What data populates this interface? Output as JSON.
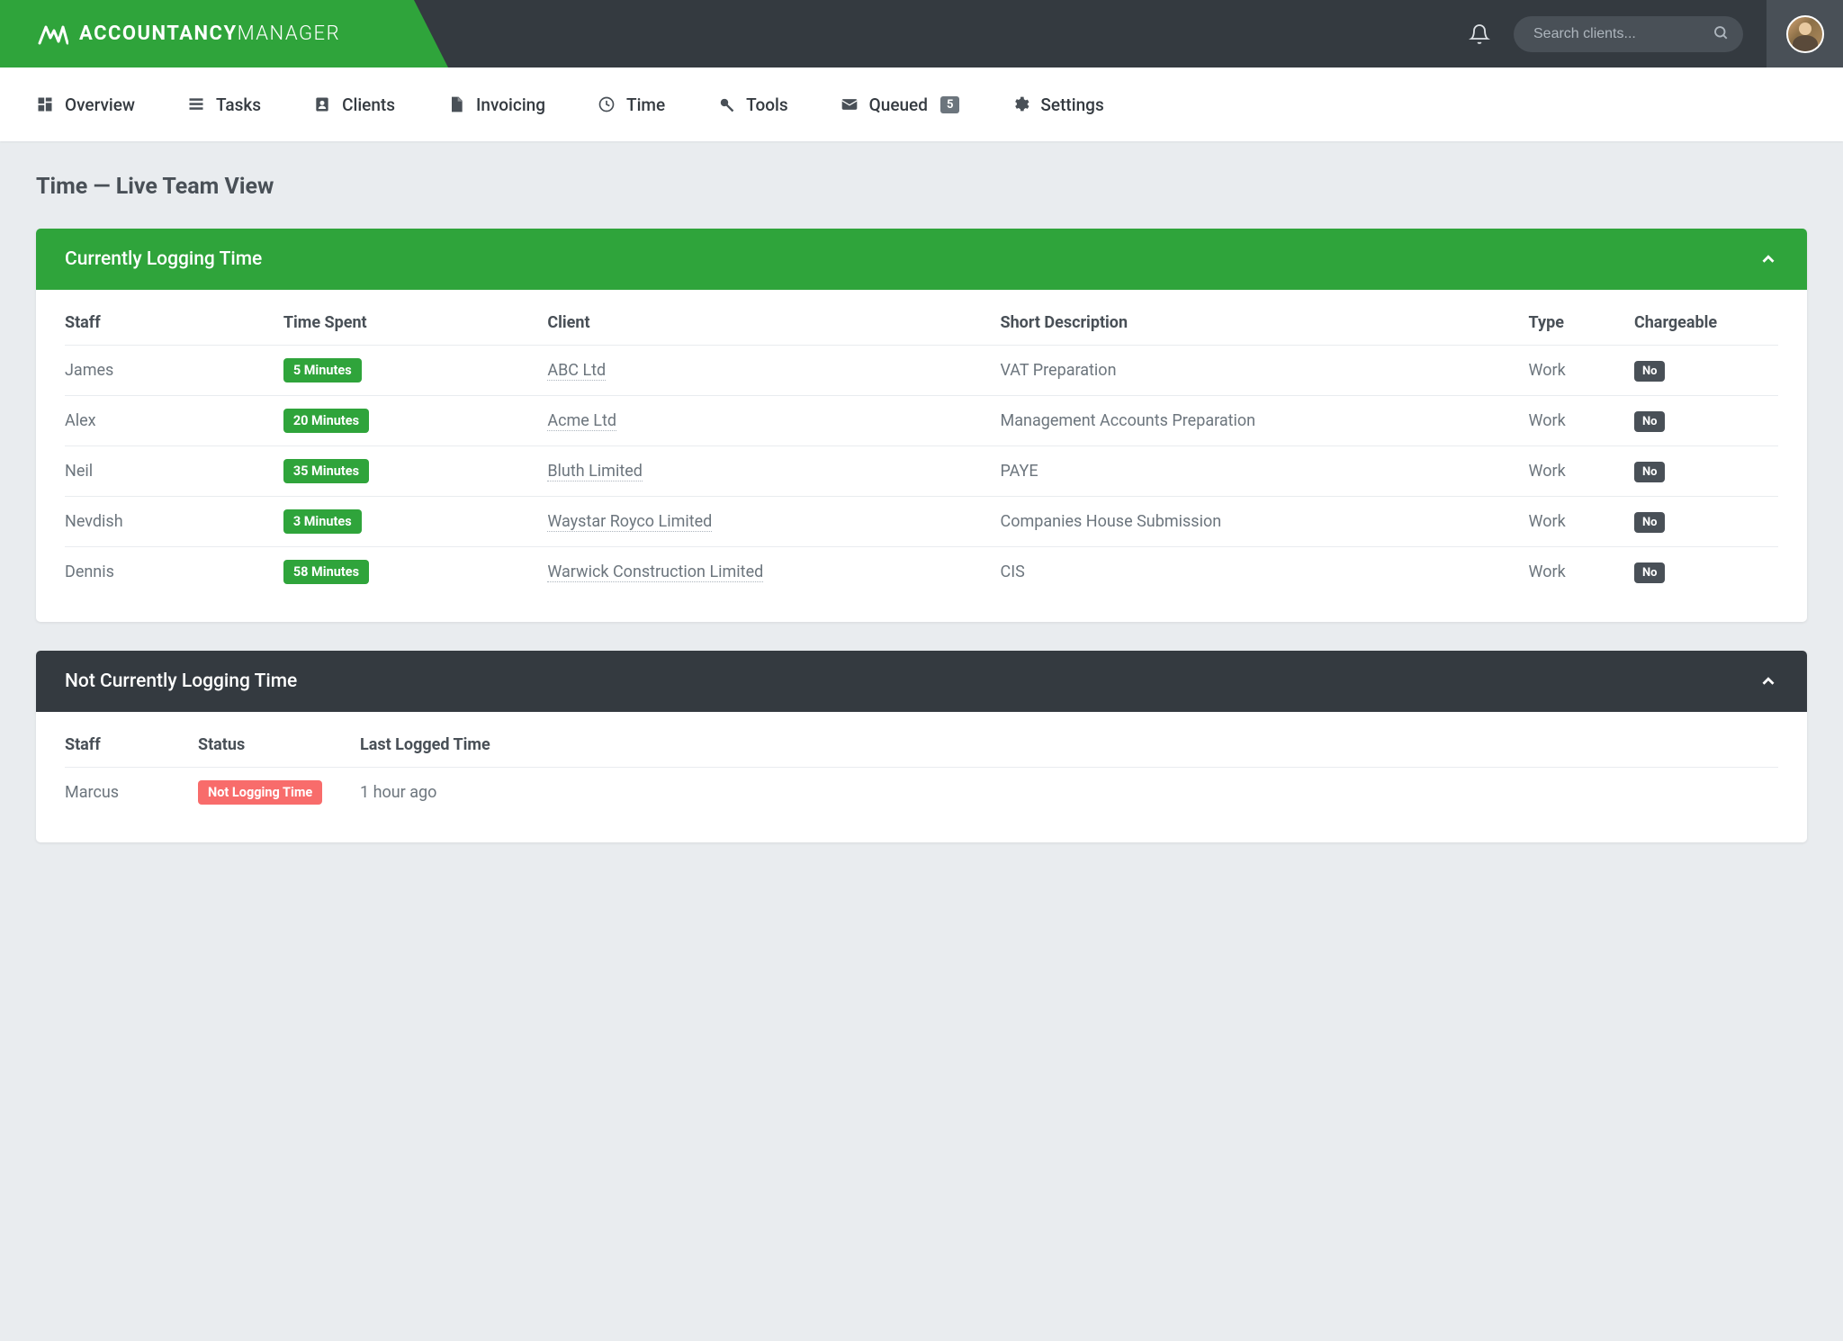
{
  "header": {
    "logo_bold": "ACCOUNTANCY",
    "logo_light": "MANAGER",
    "search_placeholder": "Search clients..."
  },
  "nav": {
    "items": [
      {
        "label": "Overview"
      },
      {
        "label": "Tasks"
      },
      {
        "label": "Clients"
      },
      {
        "label": "Invoicing"
      },
      {
        "label": "Time"
      },
      {
        "label": "Tools"
      },
      {
        "label": "Queued",
        "badge": "5"
      },
      {
        "label": "Settings"
      }
    ]
  },
  "page": {
    "title": "Time — Live Team View"
  },
  "panel_logging": {
    "title": "Currently Logging Time",
    "columns": {
      "staff": "Staff",
      "time_spent": "Time Spent",
      "client": "Client",
      "short_desc": "Short Description",
      "type": "Type",
      "chargeable": "Chargeable"
    },
    "rows": [
      {
        "staff": "James",
        "time": "5 Minutes",
        "client": "ABC Ltd",
        "desc": "VAT Preparation",
        "type": "Work",
        "chargeable": "No"
      },
      {
        "staff": "Alex",
        "time": "20 Minutes",
        "client": "Acme Ltd",
        "desc": "Management Accounts Preparation",
        "type": "Work",
        "chargeable": "No"
      },
      {
        "staff": "Neil",
        "time": "35 Minutes",
        "client": "Bluth Limited",
        "desc": "PAYE",
        "type": "Work",
        "chargeable": "No"
      },
      {
        "staff": "Nevdish",
        "time": "3 Minutes",
        "client": "Waystar Royco Limited",
        "desc": "Companies House Submission",
        "type": "Work",
        "chargeable": "No"
      },
      {
        "staff": "Dennis",
        "time": "58 Minutes",
        "client": "Warwick Construction Limited",
        "desc": "CIS",
        "type": "Work",
        "chargeable": "No"
      }
    ]
  },
  "panel_not_logging": {
    "title": "Not Currently Logging Time",
    "columns": {
      "staff": "Staff",
      "status": "Status",
      "last": "Last Logged Time"
    },
    "rows": [
      {
        "staff": "Marcus",
        "status": "Not Logging Time",
        "last": "1 hour ago"
      }
    ]
  }
}
